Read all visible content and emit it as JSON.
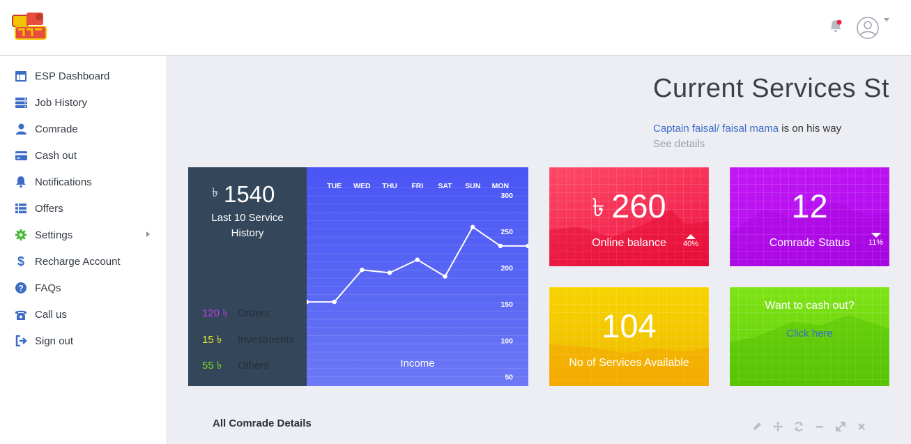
{
  "colors": {
    "sidebar_icon": "#3d6cc6",
    "settings_icon": "#44b833",
    "dark_panel": "#33465a",
    "chart_bg": "#4b55f4",
    "tile_red": "#f2234e",
    "tile_purple": "#b40df0",
    "tile_yellow": "#f2c300",
    "tile_green": "#6bd40d",
    "link": "#3d6cc6"
  },
  "header": {
    "logo_icon": "brand-logo-icon",
    "notifications_icon": "bell-icon",
    "profile_icon": "user-avatar-icon"
  },
  "sidebar": {
    "items": [
      {
        "label": "ESP Dashboard",
        "icon": "dashboard-icon"
      },
      {
        "label": "Job History",
        "icon": "server-icon"
      },
      {
        "label": "Comrade",
        "icon": "user-icon"
      },
      {
        "label": "Cash out",
        "icon": "credit-card-icon"
      },
      {
        "label": "Notifications",
        "icon": "bell-icon"
      },
      {
        "label": "Offers",
        "icon": "list-icon"
      },
      {
        "label": "Settings",
        "icon": "gear-icon"
      },
      {
        "label": "Recharge Account",
        "icon": "dollar-icon"
      },
      {
        "label": "FAQs",
        "icon": "question-icon"
      },
      {
        "label": "Call us",
        "icon": "phone-icon"
      },
      {
        "label": "Sign out",
        "icon": "sign-out-icon"
      }
    ]
  },
  "main": {
    "title": "Current Services Status",
    "status": {
      "captain": "Captain faisal/ faisal mama",
      "suffix": "is on his way",
      "see_details": "See details"
    }
  },
  "history_card": {
    "currency": "৳",
    "amount": "1540",
    "subtitle": "Last 10 Service History",
    "stats": [
      {
        "value": "120",
        "currency": "৳",
        "label": "Orders",
        "color": "#c03ee6"
      },
      {
        "value": "15",
        "currency": "৳",
        "label": "Investments",
        "color": "#e6e62a"
      },
      {
        "value": "55",
        "currency": "৳",
        "label": "Others",
        "color": "#79dd1f"
      }
    ],
    "chart_data": {
      "type": "line",
      "title": "Income",
      "x": [
        "",
        "TUE",
        "WED",
        "THU",
        "FRI",
        "SAT",
        "SUN",
        "MON",
        ""
      ],
      "series": [
        {
          "values": [
            153,
            153,
            197,
            193,
            211,
            188,
            256,
            230,
            230
          ]
        }
      ],
      "y_ticks": [
        300,
        250,
        200,
        150,
        100,
        50
      ],
      "ylim": [
        37,
        320
      ]
    }
  },
  "tiles": [
    {
      "value": "260",
      "currency": "৳",
      "label": "Online balance",
      "trend": "up",
      "percent": "40%"
    },
    {
      "value": "12",
      "label": "Comrade Status",
      "trend": "down",
      "percent": "11%"
    },
    {
      "value": "104",
      "label": "No of Services Available"
    },
    {
      "title": "Want to cash out?",
      "link": "Click here"
    }
  ],
  "details_panel": {
    "title": "All Comrade Details",
    "tools": [
      "edit-icon",
      "move-icon",
      "refresh-icon",
      "minimize-icon",
      "expand-icon",
      "close-icon"
    ]
  }
}
